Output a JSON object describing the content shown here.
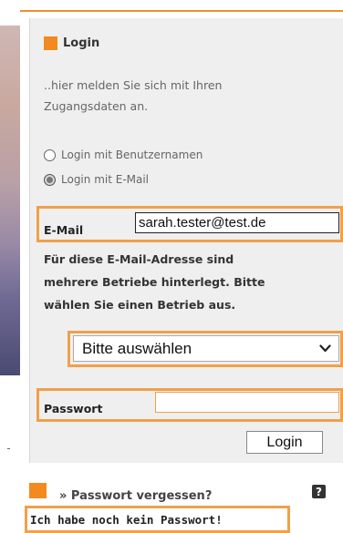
{
  "login": {
    "title": "Login",
    "intro_line1": "..hier melden Sie sich mit Ihren",
    "intro_line2": "Zugangsdaten an.",
    "radio_username": "Login mit Benutzernamen",
    "radio_email": "Login mit E-Mail",
    "selected_mode": "email",
    "email_label": "E-Mail",
    "email_value": "sarah.tester@test.de",
    "notice_line1": "Für diese E-Mail-Adresse sind",
    "notice_line2": "mehrere Betriebe hinterlegt. Bitte",
    "notice_line3": "wählen Sie einen Betrieb aus.",
    "select_value": "Bitte auswählen",
    "password_label": "Passwort",
    "password_value": "",
    "submit_label": "Login",
    "forgot_label": "» Passwort vergessen?",
    "help_label": "?",
    "no_password_label": "Ich habe noch kein Passwort!"
  },
  "colors": {
    "accent": "#f28a20",
    "highlight": "#f0a04a",
    "panel": "#efefef"
  },
  "icons": {
    "title_marker": "orange-square-icon",
    "forgot_marker": "orange-square-icon",
    "select_arrow": "chevron-down-icon",
    "help": "help-icon"
  }
}
